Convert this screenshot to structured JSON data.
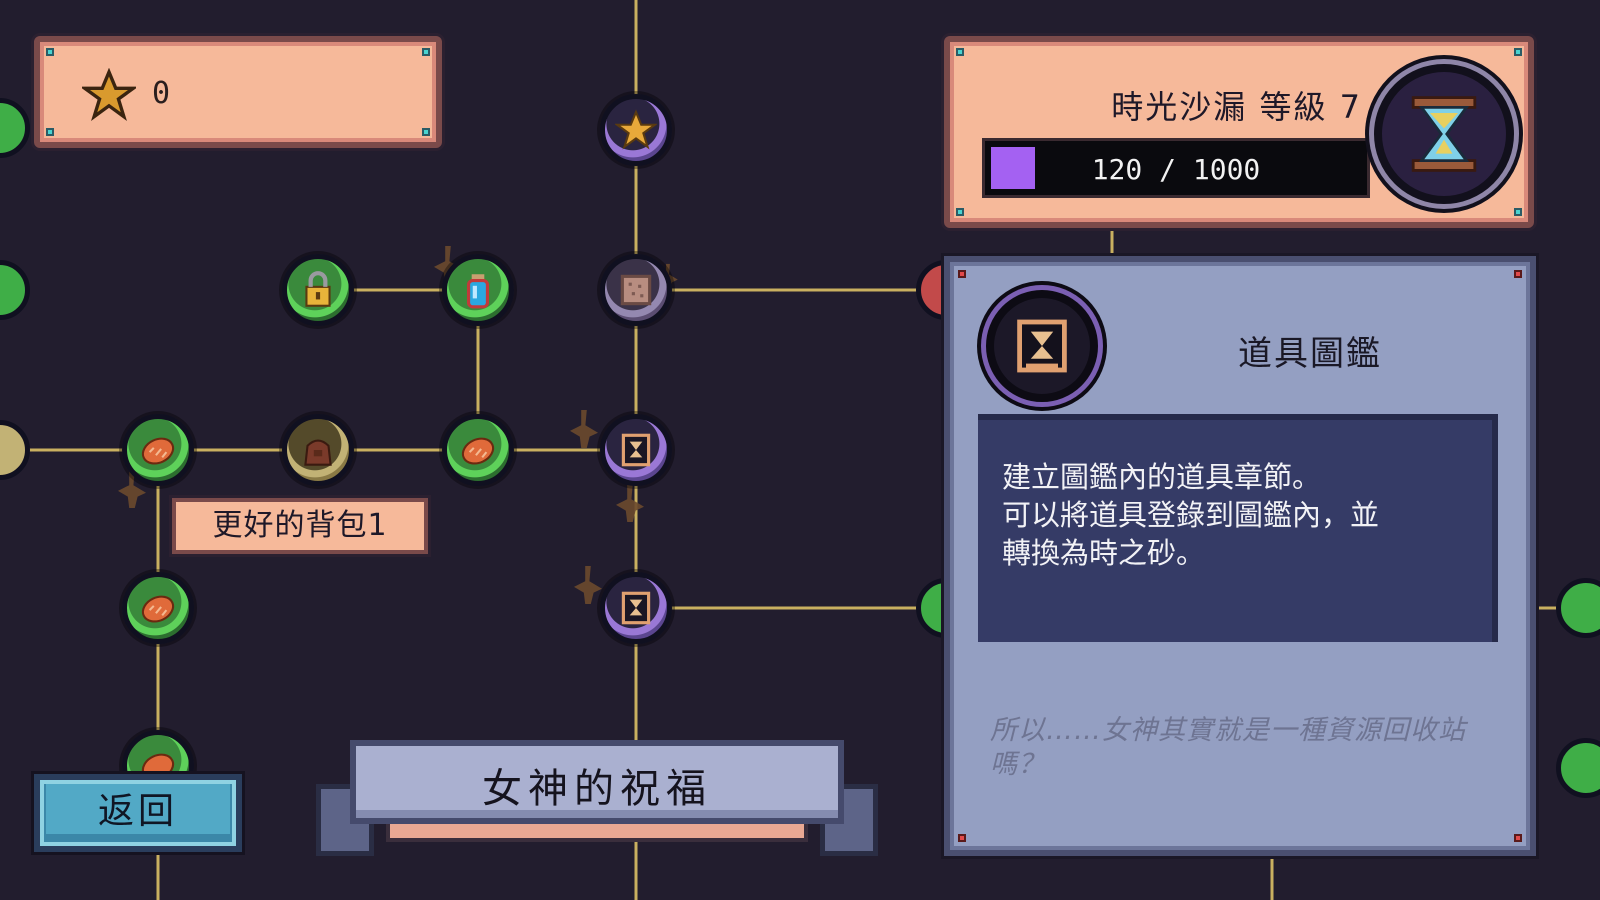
{
  "stars": {
    "count": "0"
  },
  "hourglass": {
    "title": "時光沙漏 等級 7",
    "progress_text": "120 / 1000",
    "progress_fraction": 0.12
  },
  "skill_tooltip": {
    "label": "更好的背包1"
  },
  "info": {
    "title": "道具圖鑑",
    "description": "建立圖鑑內的道具章節。\n可以將道具登錄到圖鑑內，並\n轉換為時之砂。",
    "quote": "所以……女神其實就是一種資源回收站嗎？"
  },
  "banner": {
    "title": "女神的祝福"
  },
  "buttons": {
    "back": "返回"
  },
  "colors": {
    "background": "#221d2e",
    "peach_panel": "#f6b99a",
    "info_panel": "#949fc2",
    "xp_fill": "#a461f2",
    "green_node": "#5ed15a",
    "purple_node": "#9a78d6",
    "back_button": "#52a9c6"
  },
  "icons": {
    "star": "star-icon",
    "hourglass": "hourglass-icon",
    "lock": "lock-icon",
    "potion": "potion-icon",
    "bread": "bread-icon",
    "bag": "bag-icon",
    "scroll": "scroll-icon",
    "book": "book-icon"
  }
}
